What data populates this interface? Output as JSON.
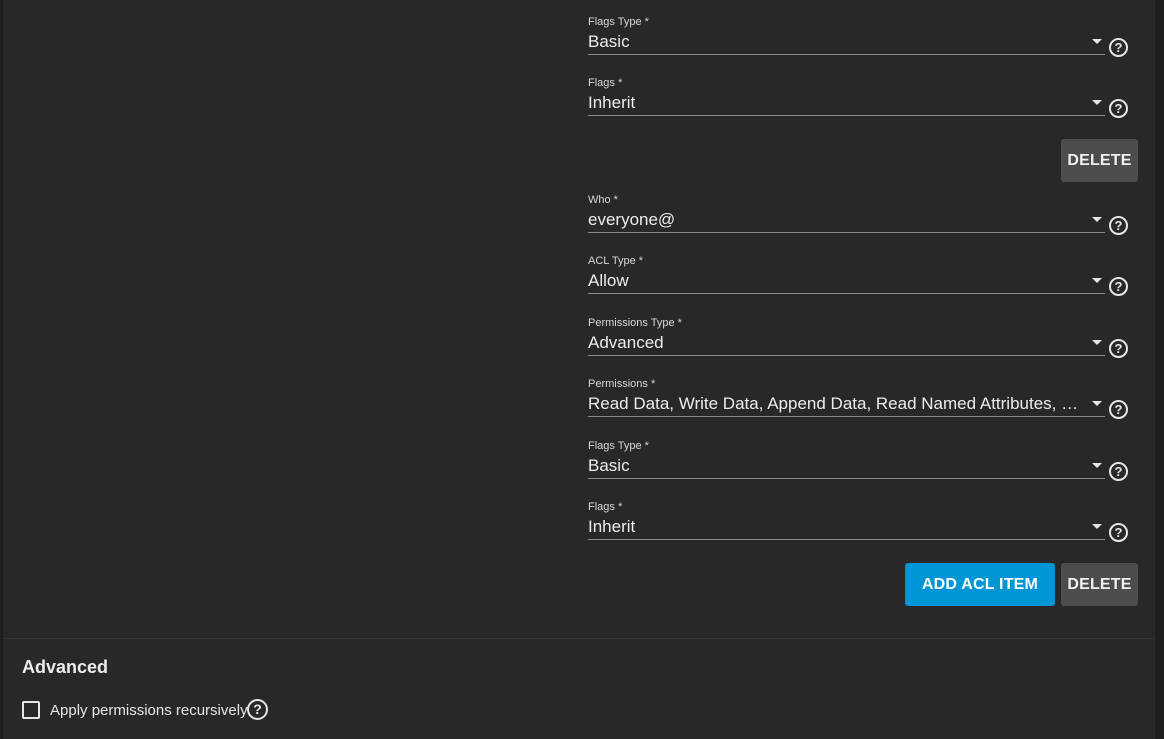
{
  "acl_entries": [
    {
      "flags_type": {
        "label": "Flags Type *",
        "value": "Basic"
      },
      "flags": {
        "label": "Flags *",
        "value": "Inherit"
      },
      "delete_label": "DELETE"
    },
    {
      "who": {
        "label": "Who *",
        "value": "everyone@"
      },
      "acl_type": {
        "label": "ACL Type *",
        "value": "Allow"
      },
      "permissions_type": {
        "label": "Permissions Type *",
        "value": "Advanced"
      },
      "permissions": {
        "label": "Permissions *",
        "value": "Read Data, Write Data, Append Data, Read Named Attributes, Write Named Attributes"
      },
      "flags_type": {
        "label": "Flags Type *",
        "value": "Basic"
      },
      "flags": {
        "label": "Flags *",
        "value": "Inherit"
      },
      "delete_label": "DELETE"
    }
  ],
  "actions": {
    "add_acl_item_label": "ADD ACL ITEM"
  },
  "advanced": {
    "title": "Advanced",
    "apply_recursively_label": "Apply permissions recursively",
    "apply_recursively_checked": false
  },
  "icons": {
    "help": "help-circle-icon",
    "dropdown": "arrow-drop-down-icon"
  },
  "colors": {
    "background": "#1e1e1e",
    "card": "#282828",
    "primary_button": "#0095d5",
    "secondary_button": "#4d4d4d"
  }
}
